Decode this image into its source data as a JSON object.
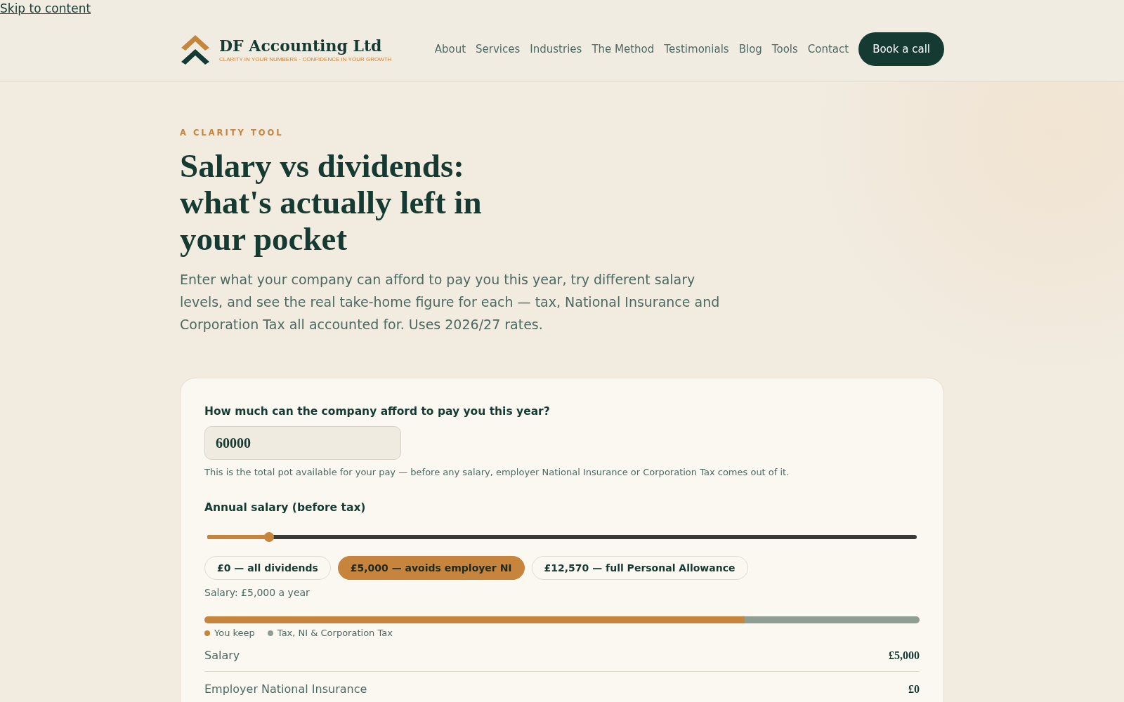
{
  "skip_link": "Skip to content",
  "brand": {
    "name": "DF Accounting Ltd",
    "tagline": "CLARITY IN YOUR NUMBERS · CONFIDENCE IN YOUR GROWTH"
  },
  "nav": [
    "About",
    "Services",
    "Industries",
    "The Method",
    "Testimonials",
    "Blog",
    "Tools",
    "Contact"
  ],
  "cta": "Book a call",
  "hero": {
    "eyebrow": "A CLARITY TOOL",
    "title": "Salary vs dividends: what's actually left in your pocket",
    "intro": "Enter what your company can afford to pay you this year, try different salary levels, and see the real take-home figure for each — tax, National Insurance and Corporation Tax all accounted for. Uses 2026/27 rates."
  },
  "calculator": {
    "pot_label": "How much can the company afford to pay you this year?",
    "pot_value": "60000",
    "pot_help": "This is the total pot available for your pay — before any salary, employer National Insurance or Corporation Tax comes out of it.",
    "salary_label": "Annual salary (before tax)",
    "salary_slider": {
      "level": 0.087
    },
    "presets": [
      {
        "label": "£0 — all dividends",
        "selected": false
      },
      {
        "label": "£5,000 — avoids employer NI",
        "selected": true
      },
      {
        "label": "£12,570 — full Personal Allowance",
        "selected": false
      }
    ],
    "salary_readout": "Salary: £5,000 a year",
    "split": {
      "level": 0.755
    },
    "legend": [
      {
        "label": "You keep",
        "color": "#c6843c"
      },
      {
        "label": "Tax, NI & Corporation Tax",
        "color": "#8e9e92"
      }
    ],
    "rows": [
      {
        "label": "Salary",
        "value": "£5,000"
      },
      {
        "label": "Employer National Insurance",
        "value": "£0"
      }
    ]
  }
}
